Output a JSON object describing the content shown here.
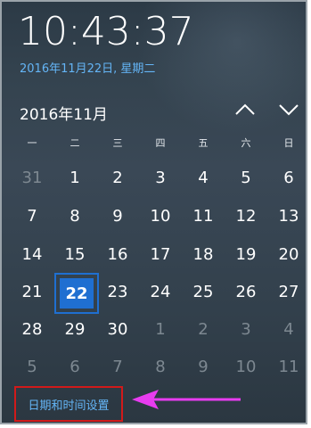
{
  "clock": {
    "time": "10:43:37"
  },
  "date_link": {
    "text": "2016年11月22日, 星期二"
  },
  "calendar": {
    "month_label": "2016年11月",
    "weekdays": [
      "一",
      "二",
      "三",
      "四",
      "五",
      "六",
      "日"
    ],
    "weeks": [
      [
        {
          "d": "31",
          "other": true
        },
        {
          "d": "1"
        },
        {
          "d": "2"
        },
        {
          "d": "3"
        },
        {
          "d": "4"
        },
        {
          "d": "5"
        },
        {
          "d": "6"
        }
      ],
      [
        {
          "d": "7"
        },
        {
          "d": "8"
        },
        {
          "d": "9"
        },
        {
          "d": "10"
        },
        {
          "d": "11"
        },
        {
          "d": "12"
        },
        {
          "d": "13"
        }
      ],
      [
        {
          "d": "14"
        },
        {
          "d": "15"
        },
        {
          "d": "16"
        },
        {
          "d": "17"
        },
        {
          "d": "18"
        },
        {
          "d": "19"
        },
        {
          "d": "20"
        }
      ],
      [
        {
          "d": "21"
        },
        {
          "d": "22",
          "today": true
        },
        {
          "d": "23"
        },
        {
          "d": "24"
        },
        {
          "d": "25"
        },
        {
          "d": "26"
        },
        {
          "d": "27"
        }
      ],
      [
        {
          "d": "28"
        },
        {
          "d": "29"
        },
        {
          "d": "30"
        },
        {
          "d": "1",
          "other": true
        },
        {
          "d": "2",
          "other": true
        },
        {
          "d": "3",
          "other": true
        },
        {
          "d": "4",
          "other": true
        }
      ],
      [
        {
          "d": "5",
          "other": true
        },
        {
          "d": "6",
          "other": true
        },
        {
          "d": "7",
          "other": true
        },
        {
          "d": "8",
          "other": true
        },
        {
          "d": "9",
          "other": true
        },
        {
          "d": "10",
          "other": true
        },
        {
          "d": "11",
          "other": true
        }
      ]
    ],
    "nav_up_icon": "chevron-up-icon",
    "nav_down_icon": "chevron-down-icon"
  },
  "settings_link": {
    "text": "日期和时间设置"
  },
  "colors": {
    "accent": "#1f6fd1",
    "link": "#64b5f6",
    "highlight_box": "#d11a1a",
    "arrow": "#e83cf0"
  }
}
